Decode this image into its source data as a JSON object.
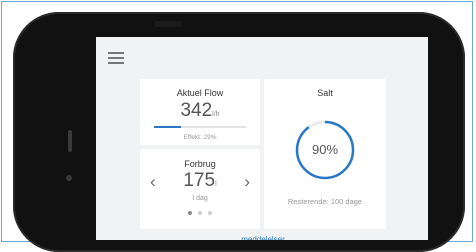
{
  "flow": {
    "title": "Aktuel Flow",
    "value": "342",
    "unit": "l/h",
    "effect_label": "Effekt: 29%",
    "effect_fraction": 0.29
  },
  "forbrug": {
    "title": "Forbrug",
    "value": "175",
    "unit": "l",
    "period": "I dag",
    "prev_icon": "chevron-left-icon",
    "next_icon": "chevron-right-icon"
  },
  "salt": {
    "title": "Salt",
    "percent_label": "90%",
    "fraction": 0.9,
    "remaining": "Resterende: 100 dage"
  },
  "footer": {
    "notifications": "meddelelser"
  },
  "colors": {
    "accent": "#2a78c5",
    "phone": "#111111",
    "screen_bg": "#f1f2f4"
  },
  "icons": {
    "menu": "hamburger-menu-icon",
    "home": "home-button-icon"
  }
}
